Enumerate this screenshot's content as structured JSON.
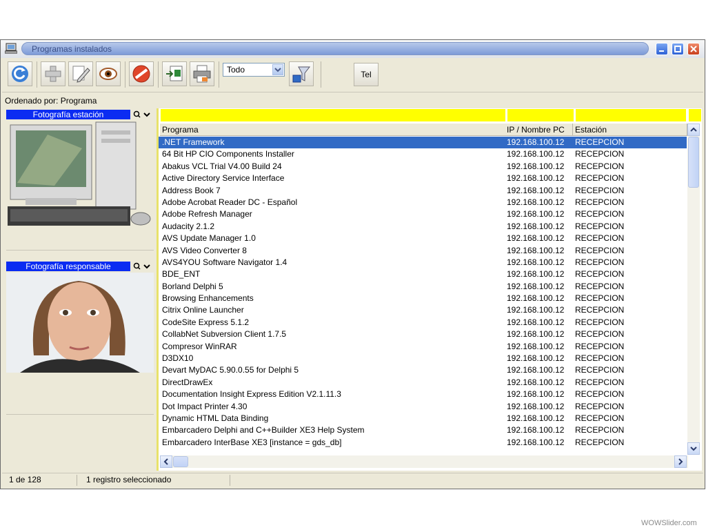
{
  "window": {
    "title": "Programas instalados"
  },
  "toolbar": {
    "filter_value": "Todo",
    "tel_label": "Tel",
    "buttons": [
      "refresh-icon",
      "add-icon",
      "edit-icon",
      "view-icon",
      "delete-icon",
      "export-excel-icon",
      "print-icon",
      "filter-icon"
    ]
  },
  "sort_label": "Ordenado por: Programa",
  "left": {
    "station_photo_label": "Fotografía estación",
    "responsible_photo_label": "Fotografía responsable"
  },
  "table": {
    "columns": [
      "Programa",
      "IP / Nombre PC",
      "Estación"
    ],
    "rows": [
      [
        ".NET Framework",
        "192.168.100.12",
        "RECEPCION"
      ],
      [
        "64 Bit HP CIO Components Installer",
        "192.168.100.12",
        "RECEPCION"
      ],
      [
        "Abakus VCL Trial V4.00 Build 24",
        "192.168.100.12",
        "RECEPCION"
      ],
      [
        "Active Directory Service Interface",
        "192.168.100.12",
        "RECEPCION"
      ],
      [
        "Address Book 7",
        "192.168.100.12",
        "RECEPCION"
      ],
      [
        "Adobe Acrobat Reader DC - Español",
        "192.168.100.12",
        "RECEPCION"
      ],
      [
        "Adobe Refresh Manager",
        "192.168.100.12",
        "RECEPCION"
      ],
      [
        "Audacity 2.1.2",
        "192.168.100.12",
        "RECEPCION"
      ],
      [
        "AVS Update Manager 1.0",
        "192.168.100.12",
        "RECEPCION"
      ],
      [
        "AVS Video Converter 8",
        "192.168.100.12",
        "RECEPCION"
      ],
      [
        "AVS4YOU Software Navigator 1.4",
        "192.168.100.12",
        "RECEPCION"
      ],
      [
        "BDE_ENT",
        "192.168.100.12",
        "RECEPCION"
      ],
      [
        "Borland Delphi 5",
        "192.168.100.12",
        "RECEPCION"
      ],
      [
        "Browsing Enhancements",
        "192.168.100.12",
        "RECEPCION"
      ],
      [
        "Citrix Online Launcher",
        "192.168.100.12",
        "RECEPCION"
      ],
      [
        "CodeSite Express 5.1.2",
        "192.168.100.12",
        "RECEPCION"
      ],
      [
        "CollabNet Subversion Client 1.7.5",
        "192.168.100.12",
        "RECEPCION"
      ],
      [
        "Compresor WinRAR",
        "192.168.100.12",
        "RECEPCION"
      ],
      [
        "D3DX10",
        "192.168.100.12",
        "RECEPCION"
      ],
      [
        "Devart MyDAC 5.90.0.55 for Delphi 5",
        "192.168.100.12",
        "RECEPCION"
      ],
      [
        "DirectDrawEx",
        "192.168.100.12",
        "RECEPCION"
      ],
      [
        "Documentation Insight Express Edition V2.1.11.3",
        "192.168.100.12",
        "RECEPCION"
      ],
      [
        "Dot Impact Printer 4.30",
        "192.168.100.12",
        "RECEPCION"
      ],
      [
        "Dynamic HTML Data Binding",
        "192.168.100.12",
        "RECEPCION"
      ],
      [
        "Embarcadero Delphi and C++Builder XE3 Help System",
        "192.168.100.12",
        "RECEPCION"
      ],
      [
        "Embarcadero InterBase XE3 [instance = gds_db]",
        "192.168.100.12",
        "RECEPCION"
      ]
    ],
    "selected_index": 0
  },
  "status": {
    "position": "1 de 128",
    "selection": "1 registro seleccionado"
  },
  "watermark": "WOWSlider.com",
  "colors": {
    "selection": "#316ac5",
    "header_blue": "#0b2cf2",
    "yellow": "#ffff00"
  }
}
